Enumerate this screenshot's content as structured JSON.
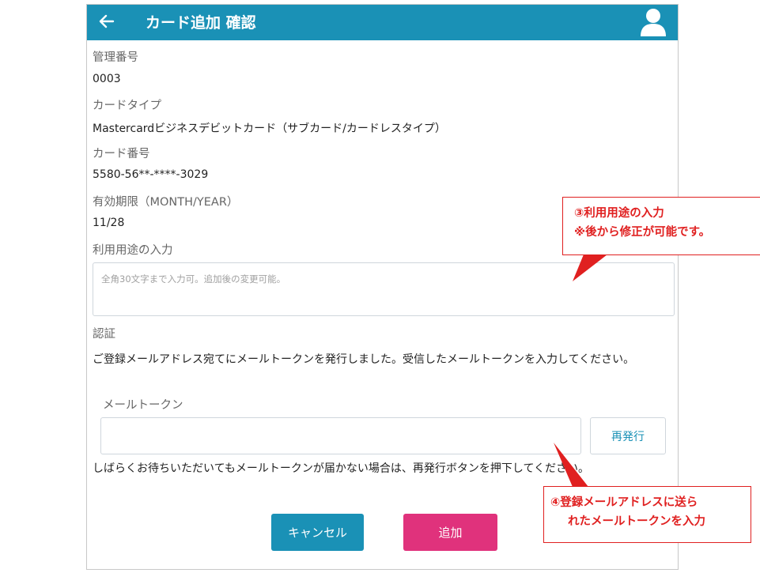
{
  "header": {
    "title": "カード追加 確認",
    "back_icon": "arrow-left-icon",
    "user_icon": "user-icon",
    "color": "#1a91b6"
  },
  "fields": {
    "management_no_label": "管理番号",
    "management_no_value": "0003",
    "card_type_label": "カードタイプ",
    "card_type_value": "Mastercardビジネスデビットカード（サブカード/カードレスタイプ）",
    "card_no_label": "カード番号",
    "card_no_value": "5580-56**-****-3029",
    "expiry_label": "有効期限（MONTH/YEAR）",
    "expiry_value": "11/28",
    "memo_label": "利用用途の入力",
    "memo_placeholder": "全角30文字まで入力可。追加後の変更可能。",
    "memo_value": ""
  },
  "auth": {
    "label": "認証",
    "description": "ご登録メールアドレス宛てにメールトークンを発行しました。受信したメールトークンを入力してください。",
    "token_label": "メールトークン",
    "token_value": "",
    "reissue_button": "再発行",
    "notice": "しばらくお待ちいただいてもメールトークンが届かない場合は、再発行ボタンを押下してください。"
  },
  "actions": {
    "cancel": "キャンセル",
    "add": "追加",
    "cancel_color": "#1a91b6",
    "add_color": "#e0327c"
  },
  "callouts": {
    "memo_line1": "③利用用途の入力",
    "memo_line2": "※後から修正が可能です。",
    "token_line1": "④登録メールアドレスに送ら",
    "token_line2": "れたメールトークンを入力",
    "color": "#e02020"
  }
}
